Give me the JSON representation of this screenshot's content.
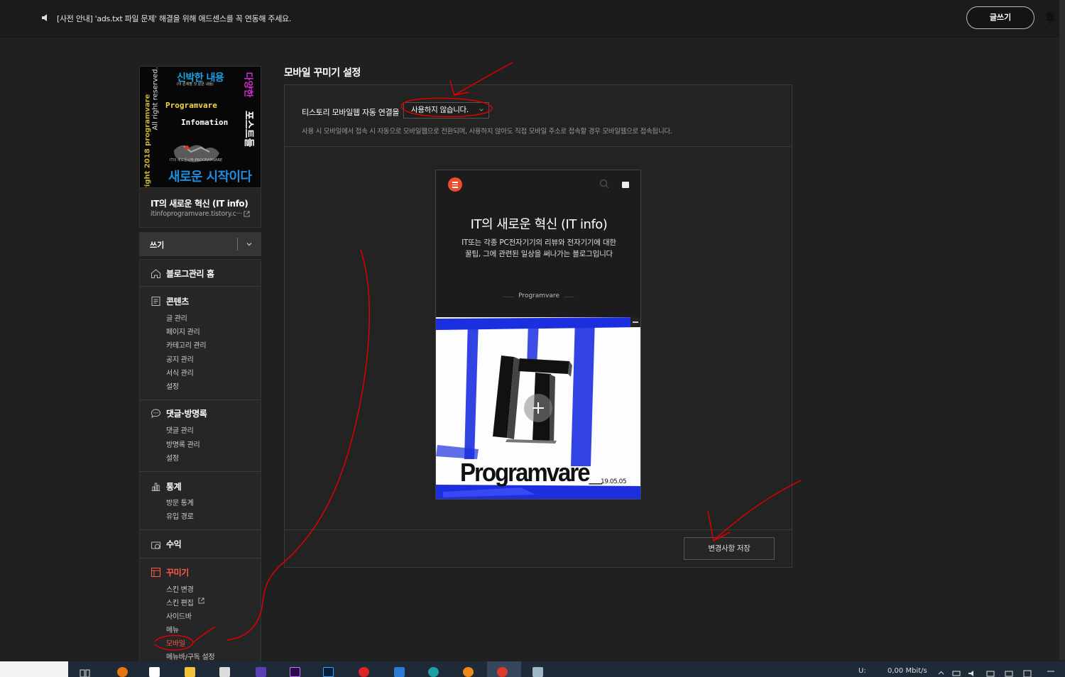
{
  "topbar": {
    "notice": "[사전 안내] 'ads.txt 파일 문제' 해결을 위해 애드센스를 꼭 연동해 주세요.",
    "write_button": "글쓰기"
  },
  "profile": {
    "cover_texts": {
      "headline": "신박한 내용",
      "headline_sub": "(이 존재할 것 같은 내용)",
      "brand": "Programvare",
      "info": "Infomation",
      "vertical_left_1": "All right reserved.",
      "vertical_left_2": "copyright 2018 programvare",
      "vertical_right_1": "다양한",
      "vertical_right_2": "포스트들",
      "small_caption": "IT의 새로운시작-PROGRAMVARE",
      "slogan": "새로운 시작이다"
    },
    "blog_title": "IT의 새로운 혁신 (IT info)",
    "blog_url": "itinfoprogramvare.tistory.c···"
  },
  "write_bar": {
    "label": "쓰기"
  },
  "nav": {
    "home": "블로그관리 홈",
    "content": {
      "title": "콘텐츠",
      "items": [
        "글 관리",
        "페이지 관리",
        "카테고리 관리",
        "공지 관리",
        "서식 관리",
        "설정"
      ]
    },
    "comments": {
      "title": "댓글·방명록",
      "items": [
        "댓글 관리",
        "방명록 관리",
        "설정"
      ]
    },
    "stats": {
      "title": "통계",
      "items": [
        "방문 통계",
        "유입 경로"
      ]
    },
    "revenue": {
      "title": "수익"
    },
    "decorate": {
      "title": "꾸미기",
      "items": [
        "스킨 변경",
        "스킨 편집",
        "사이드바",
        "메뉴",
        "모바일",
        "메뉴바/구독 설정"
      ]
    }
  },
  "main": {
    "title": "모바일 꾸미기 설정",
    "setting_label": "티스토리 모바일웹 자동 연결을",
    "setting_value": "사용하지 않습니다.",
    "setting_help": "사용 시 모바일에서 접속 시 자동으로 모바일웹으로 전환되며, 사용하지 않아도 직접 모바일 주소로 접속할 경우 모바일웹으로 접속됩니다.",
    "save_button": "변경사항 저장"
  },
  "preview": {
    "title": "IT의 새로운 혁신 (IT info)",
    "description": "IT또는 각종 PC전자기기의 리뷰와 전자기기에 대한 꿀팁, 그에 관련된 일상을 써나가는 블로그입니다",
    "author": "Programvare",
    "cover_text": "Programvare_",
    "cover_date": "19.05.05",
    "cover_logo": "IT"
  },
  "taskbar": {
    "tray_label": "U:",
    "network_speed": "0,00 Mbit/s"
  },
  "colors": {
    "accent_red": "#ff5a4a",
    "menu_orange": "#ef4d2c",
    "annotation_red": "#e00000"
  }
}
